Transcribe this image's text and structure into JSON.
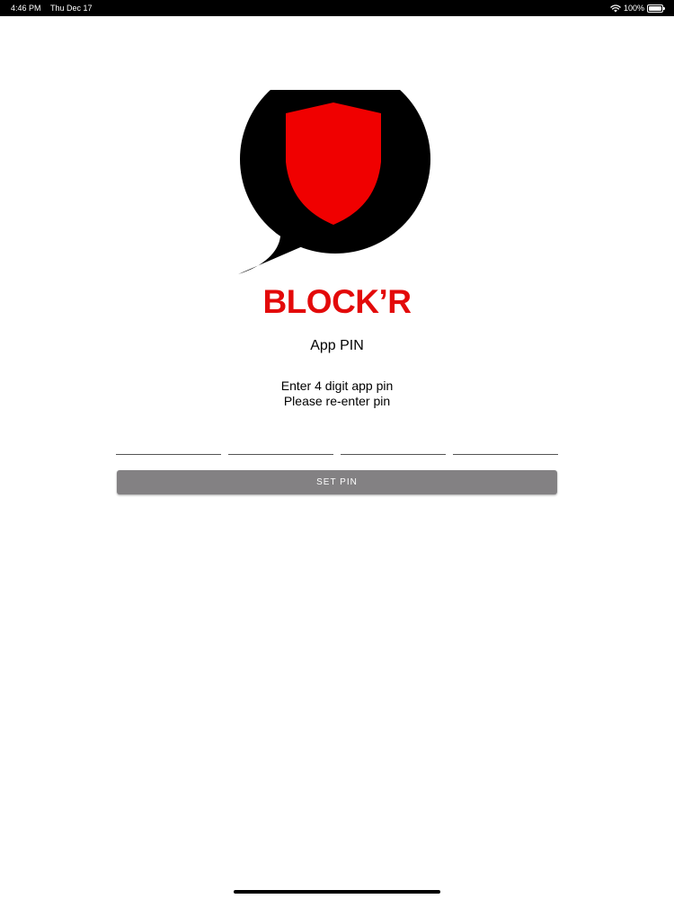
{
  "status_bar": {
    "time": "4:46 PM",
    "date": "Thu Dec 17",
    "battery_text": "100%",
    "battery_level": 1.0,
    "icons": [
      "wifi-icon",
      "battery-icon"
    ]
  },
  "brand": {
    "name": "BLOCK’R",
    "logo_icon": "speech-bubble-shield-icon",
    "colors": {
      "bubble": "#000000",
      "shield": "#f00000",
      "text": "#e30a0a"
    }
  },
  "screen": {
    "title": "App PIN",
    "instruction_1": "Enter 4 digit app pin",
    "instruction_2": "Please re-enter pin"
  },
  "pin_fields": [
    {
      "value": "",
      "placeholder": ""
    },
    {
      "value": "",
      "placeholder": ""
    },
    {
      "value": "",
      "placeholder": ""
    },
    {
      "value": "",
      "placeholder": ""
    }
  ],
  "set_pin_button": {
    "label": "SET PIN",
    "background_color": "#838183",
    "text_color": "#ffffff"
  }
}
